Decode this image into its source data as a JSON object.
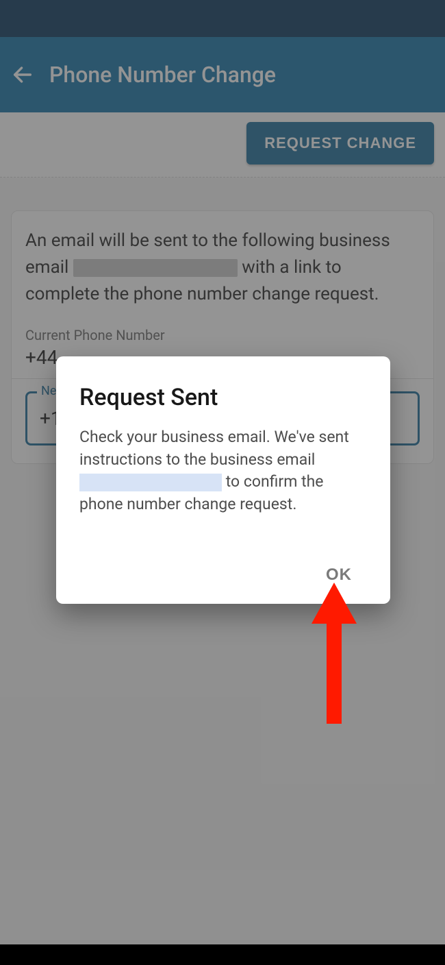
{
  "appbar": {
    "title": "Phone Number Change"
  },
  "actions": {
    "request_change": "REQUEST CHANGE"
  },
  "info": {
    "text_a": "An email will be sent to the following business email ",
    "text_b": "with a link to complete the phone number change request."
  },
  "fields": {
    "current_label": "Current Phone Number",
    "current_value": "+44",
    "new_label": "Ne",
    "new_value": "+1"
  },
  "dialog": {
    "title": "Request Sent",
    "body_a": "Check your business email. We've sent instructions to the business email ",
    "body_b": " to confirm the phone number change request.",
    "ok": "OK"
  }
}
